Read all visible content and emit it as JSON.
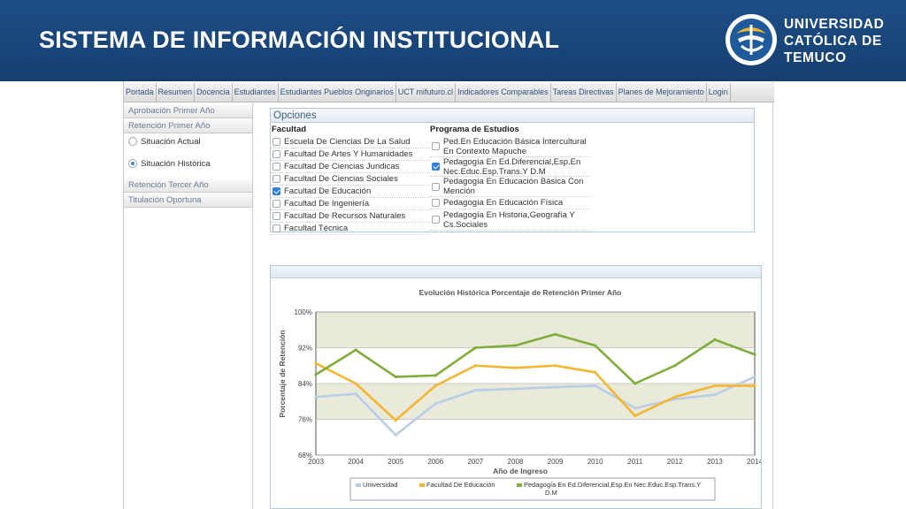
{
  "banner": {
    "title": "SISTEMA DE INFORMACIÓN INSTITUCIONAL"
  },
  "logo": {
    "line1": "UNIVERSIDAD",
    "line2": "CATÓLICA DE",
    "line3": "TEMUCO"
  },
  "nav": [
    "Portada",
    "Resumen",
    "Docencia",
    "Estudiantes",
    "Estudiantes Pueblos Originarios",
    "UCT mifuturo.cl",
    "Indicadores Comparables",
    "Tareas Directivas",
    "Planes de Mejoramiento",
    "Login"
  ],
  "sidebar": {
    "items": [
      "Aprobación Primer Año",
      "Retención Primer Año",
      "Retención Tercer Año",
      "Titulación Oportuna"
    ],
    "radios": [
      {
        "label": "Situación Actual",
        "checked": false
      },
      {
        "label": "Situación Histórica",
        "checked": true
      }
    ]
  },
  "opciones": {
    "title": "Opciones",
    "facultad_header": "Facultad",
    "programa_header": "Programa de Estudios",
    "facultades": [
      {
        "label": "Escuela De Ciencias De La Salud",
        "checked": false
      },
      {
        "label": "Facultad De Artes Y Humanidades",
        "checked": false
      },
      {
        "label": "Facultad De Ciencias Juridicas",
        "checked": false
      },
      {
        "label": "Facultad De Ciencias Sociales",
        "checked": false
      },
      {
        "label": "Facultad De Educación",
        "checked": true
      },
      {
        "label": "Facultad De Ingeniería",
        "checked": false
      },
      {
        "label": "Facultad De Recursos Naturales",
        "checked": false
      },
      {
        "label": "Facultad Técnica",
        "checked": false
      }
    ],
    "programas": [
      {
        "label": "Ped.En Educación Básica Intercultural En Contexto Mapuche",
        "checked": false
      },
      {
        "label": "Pedagogía En Ed.Diferencial,Esp.En Nec.Educ.Esp.Trans.Y D.M",
        "checked": true
      },
      {
        "label": "Pedagogía En Educación Básica Con Mención",
        "checked": false
      },
      {
        "label": "Pedagogía En Educación Física",
        "checked": false
      },
      {
        "label": "Pedagogía En Historia,Geografía Y Cs.Sociales",
        "checked": false
      }
    ]
  },
  "chart_data": {
    "type": "line",
    "title": "Evolución Histórica Porcentaje de Retención Primer Año",
    "xlabel": "Año de Ingreso",
    "ylabel": "Porcentaje de Retención",
    "x": [
      "2003",
      "2004",
      "2005",
      "2006",
      "2007",
      "2008",
      "2009",
      "2010",
      "2011",
      "2012",
      "2013",
      "2014"
    ],
    "ylim": [
      68,
      100
    ],
    "yticks": [
      "68%",
      "76%",
      "84%",
      "92%",
      "100%"
    ],
    "series": [
      {
        "name": "Universidad",
        "color": "#b9cde4",
        "values": [
          81,
          81.7,
          72.5,
          79.5,
          82.5,
          82.8,
          83.2,
          83.5,
          78.5,
          80.5,
          81.5,
          85.5
        ]
      },
      {
        "name": "Facultad De Educación",
        "color": "#f2b632",
        "values": [
          88.5,
          84,
          75.8,
          83.5,
          88,
          87.5,
          88,
          86.5,
          76.8,
          81,
          83.5,
          83.5
        ]
      },
      {
        "name": "Pedagogía En Ed.Diferencial,Esp.En Nec.Educ.Esp.Trans.Y D.M",
        "color": "#7fae3c",
        "values": [
          86,
          91.5,
          85.5,
          85.8,
          92,
          92.5,
          95,
          92.5,
          84,
          88,
          93.8,
          90.5
        ]
      }
    ]
  }
}
